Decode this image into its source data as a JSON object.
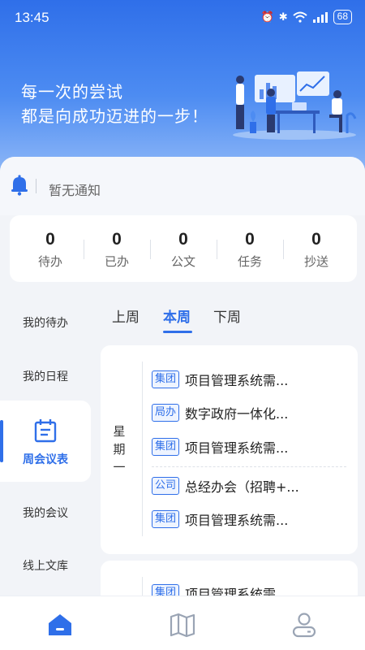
{
  "status_bar": {
    "time": "13:45",
    "battery": "68",
    "icons": [
      "alarm-icon",
      "bluetooth-icon",
      "wifi-icon",
      "signal-4g-icon",
      "battery-icon"
    ]
  },
  "banner": {
    "line1": "每一次的尝试",
    "line2": "都是向成功迈进的一步！"
  },
  "notice": {
    "text": "暂无通知",
    "icon": "bell-icon"
  },
  "stats": [
    {
      "value": "0",
      "label": "待办"
    },
    {
      "value": "0",
      "label": "已办"
    },
    {
      "value": "0",
      "label": "公文"
    },
    {
      "value": "0",
      "label": "任务"
    },
    {
      "value": "0",
      "label": "抄送"
    }
  ],
  "sidebar": {
    "items": [
      {
        "label": "我的待办"
      },
      {
        "label": "我的日程"
      },
      {
        "label": "周会议表",
        "active": true,
        "icon": "calendar-icon"
      },
      {
        "label": "我的会议"
      },
      {
        "label": "线上文库"
      }
    ]
  },
  "week_tabs": [
    {
      "label": "上周"
    },
    {
      "label": "本周",
      "active": true
    },
    {
      "label": "下周"
    }
  ],
  "days": [
    {
      "label": "星期一",
      "meetings": [
        {
          "tag": "集团",
          "title": "项目管理系统需..."
        },
        {
          "tag": "局办",
          "title": "数字政府一体化..."
        },
        {
          "tag": "集团",
          "title": "项目管理系统需..."
        },
        {
          "tag": "公司",
          "title": "总经办会（招聘+..."
        },
        {
          "tag": "集团",
          "title": "项目管理系统需..."
        }
      ]
    },
    {
      "label": "",
      "meetings": [
        {
          "tag": "集团",
          "title": "项目管理系统需..."
        }
      ]
    }
  ],
  "bottom_nav": [
    {
      "icon": "home-icon",
      "active": true
    },
    {
      "icon": "map-icon"
    },
    {
      "icon": "profile-icon"
    }
  ],
  "colors": {
    "accent": "#2f6fe9",
    "header_top": "#2f6fe9",
    "header_bottom": "#8fb8f7",
    "background": "#f2f4f8"
  }
}
